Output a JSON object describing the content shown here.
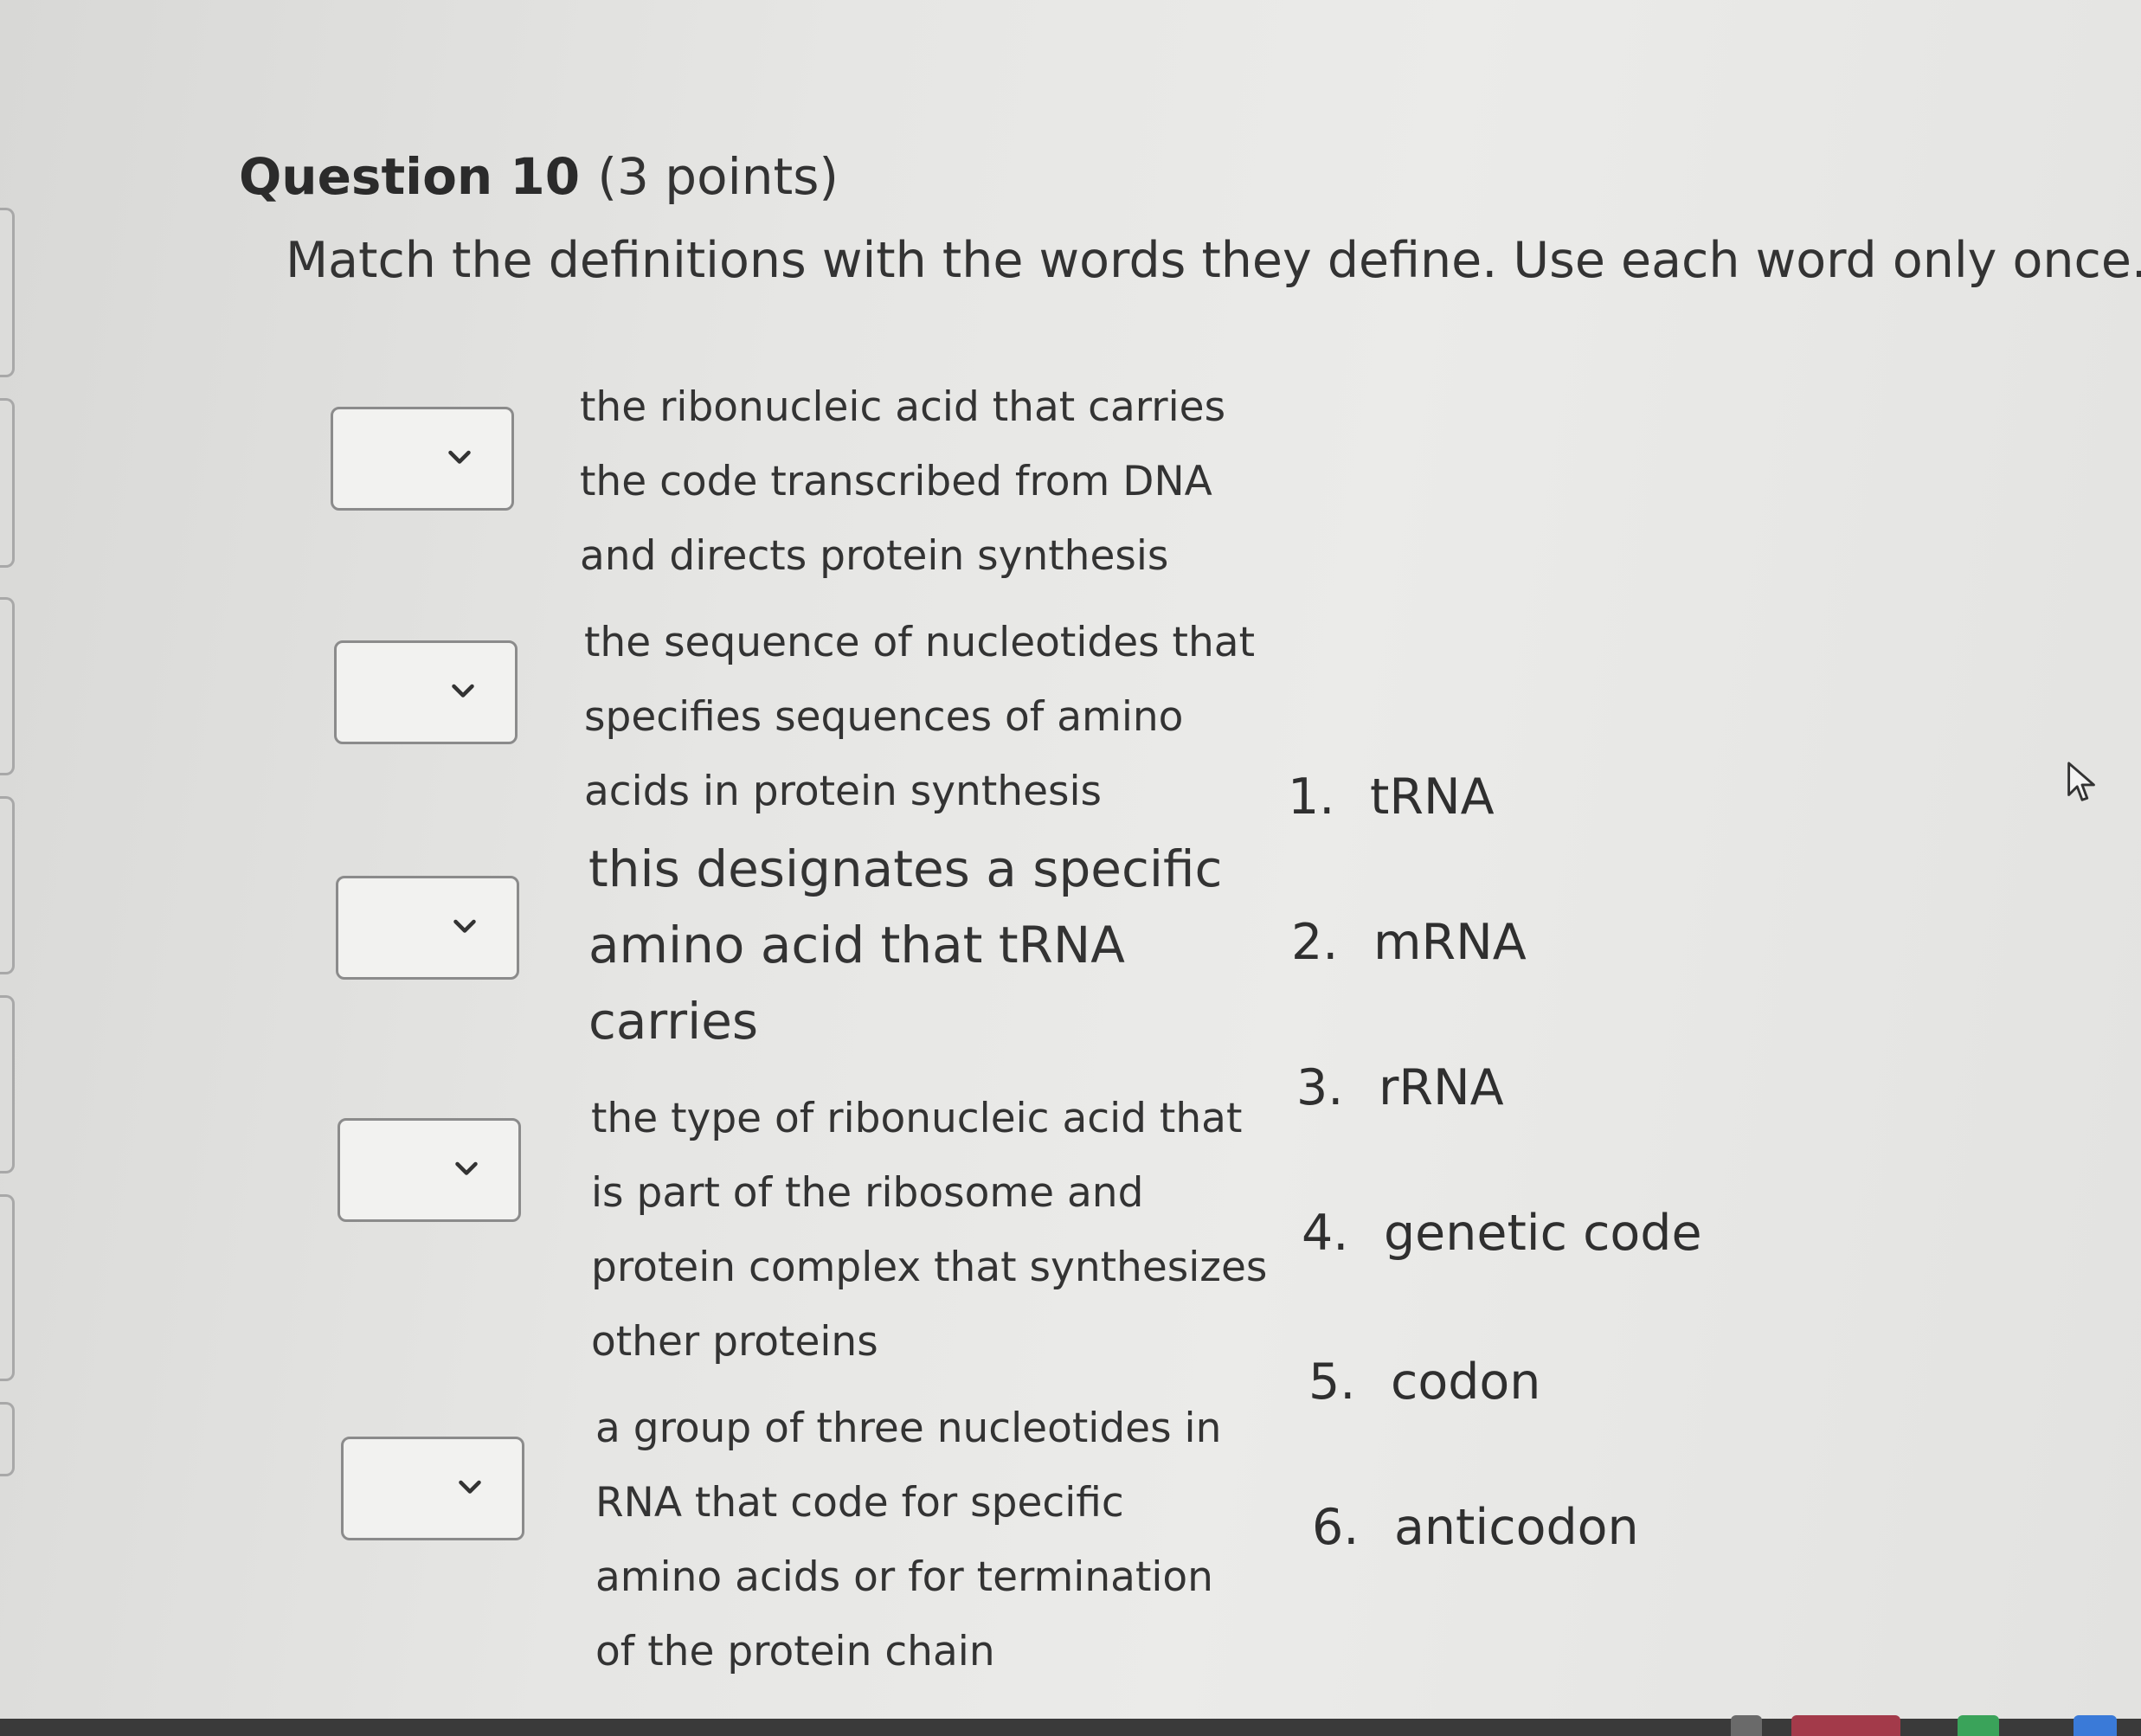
{
  "question": {
    "number_label": "Question 10",
    "points_label": "(3 points)",
    "instructions": "Match the definitions with the words they define. Use each word only once."
  },
  "definitions": [
    {
      "lines": [
        "the ribonucleic acid that carries",
        "the code transcribed from DNA",
        "and directs protein synthesis"
      ],
      "selected": ""
    },
    {
      "lines": [
        "the sequence of nucleotides that",
        "specifies sequences of amino",
        "acids in protein synthesis"
      ],
      "selected": ""
    },
    {
      "lines": [
        "this designates a specific",
        "amino acid that tRNA",
        "carries"
      ],
      "selected": ""
    },
    {
      "lines": [
        "the type of ribonucleic acid that",
        "is part of the ribosome and",
        "protein complex that synthesizes",
        "other proteins"
      ],
      "selected": ""
    },
    {
      "lines": [
        "a group of three nucleotides in",
        "RNA that code for specific",
        "amino acids or for termination",
        "of the protein chain"
      ],
      "selected": ""
    }
  ],
  "words": [
    {
      "index": "1.",
      "label": "tRNA"
    },
    {
      "index": "2.",
      "label": "mRNA"
    },
    {
      "index": "3.",
      "label": "rRNA"
    },
    {
      "index": "4.",
      "label": "genetic code"
    },
    {
      "index": "5.",
      "label": "codon"
    },
    {
      "index": "6.",
      "label": "anticodon"
    }
  ],
  "icons": {
    "dropdown": "chevron-down-icon",
    "cursor": "mouse-pointer-icon"
  },
  "colors": {
    "background": "#e2e2e0",
    "text": "#2f2f2f",
    "select_border": "#8b8b8b",
    "taskbar": "#3a3a3a"
  }
}
